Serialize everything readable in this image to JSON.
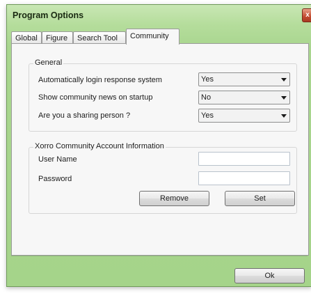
{
  "window": {
    "title": "Program Options",
    "close_glyph": "x"
  },
  "tabs": [
    {
      "label": "Global",
      "active": false
    },
    {
      "label": "Figure",
      "active": false
    },
    {
      "label": "Search Tool",
      "active": false
    },
    {
      "label": "Community",
      "active": true
    }
  ],
  "general": {
    "title": "General",
    "rows": [
      {
        "label": "Automatically login response system",
        "value": "Yes"
      },
      {
        "label": "Show community news on startup",
        "value": "No"
      },
      {
        "label": "Are you a sharing person ?",
        "value": "Yes"
      }
    ]
  },
  "account": {
    "title": "Xorro Community Account Information",
    "username_label": "User Name",
    "username_value": "",
    "password_label": "Password",
    "password_value": "",
    "remove_label": "Remove",
    "set_label": "Set"
  },
  "footer": {
    "ok_label": "Ok"
  }
}
